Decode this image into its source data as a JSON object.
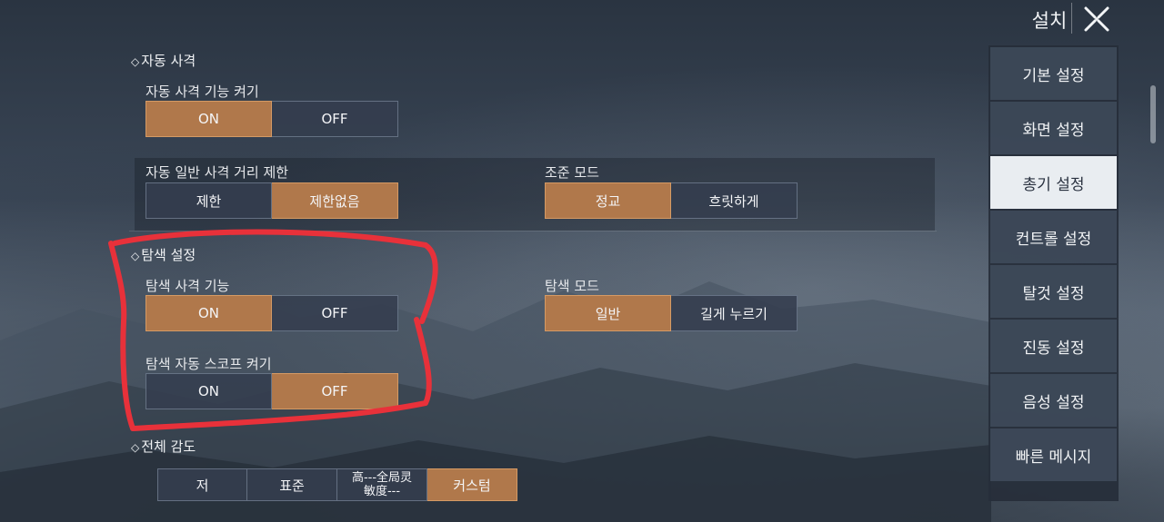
{
  "header": {
    "title": "설치",
    "close_icon": "close-x-icon"
  },
  "auto_fire": {
    "section_title": "자동 사격",
    "toggle": {
      "label": "자동 사격 기능 켜기",
      "options": [
        "ON",
        "OFF"
      ],
      "selected": "ON"
    },
    "distance": {
      "label": "자동 일반 사격 거리 제한",
      "options": [
        "제한",
        "제한없음"
      ],
      "selected": "제한없음"
    },
    "aim_mode": {
      "label": "조준 모드",
      "options": [
        "정교",
        "흐릿하게"
      ],
      "selected": "정교"
    }
  },
  "scan": {
    "section_title": "탐색 설정",
    "scan_fire": {
      "label": "탐색 사격 기능",
      "options": [
        "ON",
        "OFF"
      ],
      "selected": "ON"
    },
    "scan_mode": {
      "label": "탐색 모드",
      "options": [
        "일반",
        "길게 누르기"
      ],
      "selected": "일반"
    },
    "auto_scope": {
      "label": "탐색 자동 스코프 켜기",
      "options": [
        "ON",
        "OFF"
      ],
      "selected": "OFF"
    }
  },
  "sensitivity": {
    "section_title": "전체 감도",
    "options": [
      "저",
      "표준",
      "高---全局灵\n敏度---",
      "커스텀"
    ],
    "selected": "커스텀"
  },
  "sidebar": {
    "items": [
      "기본 설정",
      "화면 설정",
      "총기 설정",
      "컨트롤 설정",
      "탈것 설정",
      "진동 설정",
      "음성 설정",
      "빠른 메시지"
    ],
    "active": "총기 설정"
  },
  "colors": {
    "accent": "#b0784b",
    "annotation": "#e8313a"
  }
}
